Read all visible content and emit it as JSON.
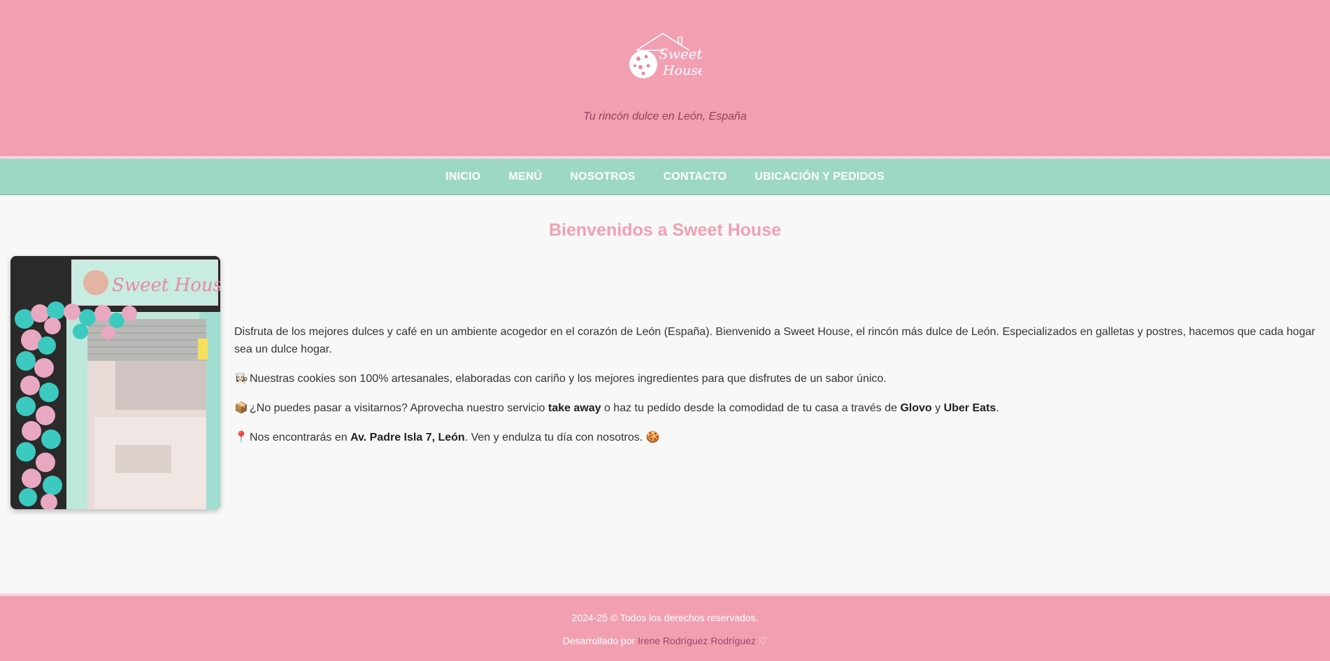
{
  "header": {
    "logo_alt": "Sweet House",
    "tagline": "Tu rincón dulce en León, España"
  },
  "nav": {
    "items": [
      "INICIO",
      "MENÚ",
      "NOSOTROS",
      "CONTACTO",
      "UBICACIÓN Y PEDIDOS"
    ]
  },
  "main": {
    "title": "Bienvenidos a Sweet House",
    "intro": "Disfruta de los mejores dulces y café en un ambiente acogedor en el corazón de León (España). Bienvenido a Sweet House, el rincón más dulce de León. Especializados en galletas y postres, hacemos que cada hogar sea un dulce hogar.",
    "p1": {
      "icon": "chef-icon",
      "text": "Nuestras cookies son 100% artesanales, elaboradas con cariño y los mejores ingredientes para que disfrutes de un sabor único."
    },
    "p2": {
      "icon": "package-icon",
      "t1": "¿No puedes pasar a visitarnos? Aprovecha nuestro servicio ",
      "b1": "take away",
      "t2": " o haz tu pedido desde la comodidad de tu casa a través de ",
      "b2": "Glovo",
      "t3": " y ",
      "b3": "Uber Eats",
      "t4": "."
    },
    "p3": {
      "icon": "pin-icon",
      "t1": "Nos encontrarás en ",
      "b1": "Av. Padre Isla 7, León",
      "t2": ". Ven y endulza tu día con nosotros. ",
      "end_icon": "cookie-icon"
    }
  },
  "footer": {
    "copyright": "2024-25 © Todos los derechos reservados.",
    "dev_prefix": "Desarrollado por ",
    "dev_name": "Irene Rodríguez Rodríguez",
    "heart": "♡"
  },
  "colors": {
    "pink": "#f2a0b1",
    "mint": "#9dd8c4",
    "accent_text": "#a3426a"
  }
}
